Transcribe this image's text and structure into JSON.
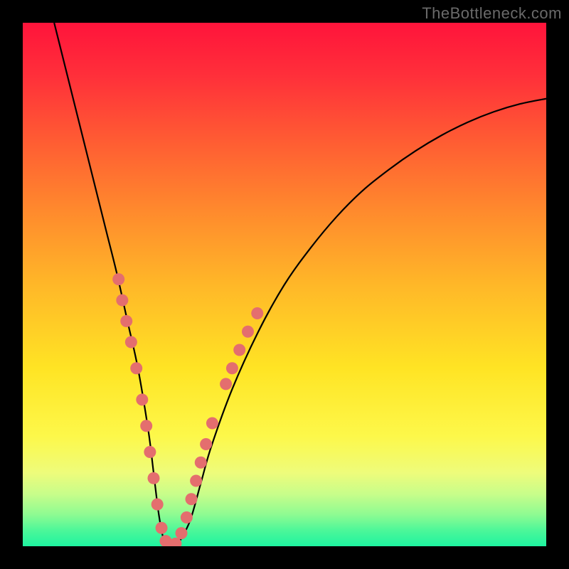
{
  "watermark": "TheBottleneck.com",
  "chart_data": {
    "type": "line",
    "title": "",
    "xlabel": "",
    "ylabel": "",
    "xlim": [
      0,
      100
    ],
    "ylim": [
      0,
      100
    ],
    "series": [
      {
        "name": "bottleneck-curve",
        "x": [
          6,
          8,
          10,
          12,
          14,
          16,
          18,
          20,
          22,
          24,
          25,
          26,
          27,
          28,
          29,
          30,
          32,
          34,
          36,
          40,
          45,
          50,
          55,
          60,
          65,
          70,
          75,
          80,
          85,
          90,
          95,
          100
        ],
        "y": [
          100,
          92,
          84,
          76,
          68,
          60,
          52,
          43,
          34,
          22,
          14,
          6,
          1,
          0,
          0,
          1,
          5,
          12,
          19,
          30,
          41,
          50,
          57,
          63,
          68,
          72,
          75.5,
          78.5,
          81,
          83,
          84.5,
          85.5
        ]
      }
    ],
    "markers": {
      "name": "highlight-dots",
      "color": "#e46e6e",
      "points": [
        {
          "x": 18.3,
          "y": 51
        },
        {
          "x": 19.0,
          "y": 47
        },
        {
          "x": 19.8,
          "y": 43
        },
        {
          "x": 20.7,
          "y": 39
        },
        {
          "x": 21.7,
          "y": 34
        },
        {
          "x": 22.8,
          "y": 28
        },
        {
          "x": 23.6,
          "y": 23
        },
        {
          "x": 24.3,
          "y": 18
        },
        {
          "x": 25.0,
          "y": 13
        },
        {
          "x": 25.7,
          "y": 8
        },
        {
          "x": 26.5,
          "y": 3.5
        },
        {
          "x": 27.3,
          "y": 1
        },
        {
          "x": 28.2,
          "y": 0.2
        },
        {
          "x": 29.2,
          "y": 0.5
        },
        {
          "x": 30.3,
          "y": 2.5
        },
        {
          "x": 31.3,
          "y": 5.5
        },
        {
          "x": 32.2,
          "y": 9
        },
        {
          "x": 33.1,
          "y": 12.5
        },
        {
          "x": 34.0,
          "y": 16
        },
        {
          "x": 35.0,
          "y": 19.5
        },
        {
          "x": 36.2,
          "y": 23.5
        },
        {
          "x": 38.8,
          "y": 31
        },
        {
          "x": 40.0,
          "y": 34
        },
        {
          "x": 41.4,
          "y": 37.5
        },
        {
          "x": 43.0,
          "y": 41
        },
        {
          "x": 44.8,
          "y": 44.5
        }
      ]
    }
  }
}
